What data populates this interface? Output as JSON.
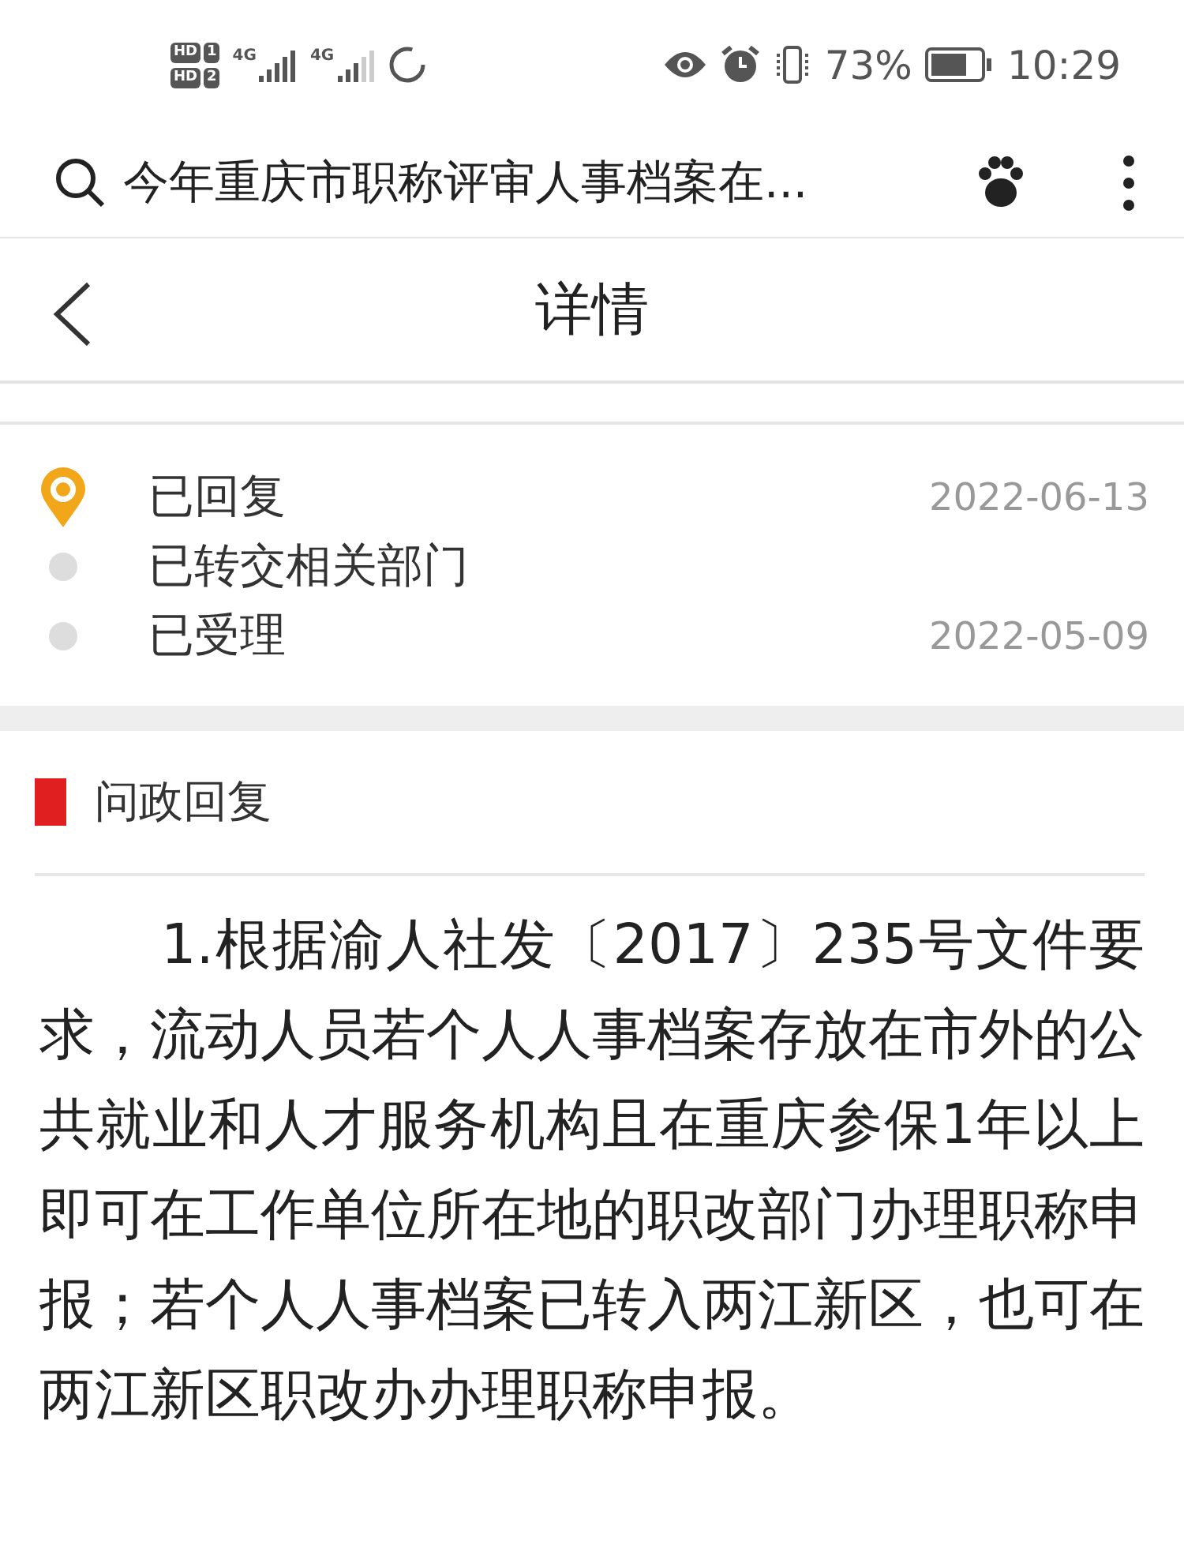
{
  "status_bar": {
    "sims": [
      {
        "hd": "HD",
        "slot": "1"
      },
      {
        "hd": "HD",
        "slot": "2"
      }
    ],
    "networks": [
      {
        "label": "4G"
      },
      {
        "label": "4G"
      }
    ],
    "battery": "73%",
    "time": "10:29"
  },
  "search_bar": {
    "query": "今年重庆市职称评审人事档案在..."
  },
  "header": {
    "title": "详情"
  },
  "timeline": [
    {
      "label": "已回复",
      "date": "2022-06-13",
      "selected": true
    },
    {
      "label": "已转交相关部门",
      "selected": false
    },
    {
      "label": "已受理",
      "date": "2022-05-09",
      "selected": false
    }
  ],
  "section": {
    "title": "问政回复"
  },
  "reply": "1.根据渝人社发〔2017〕235号文件要求，流动人员若个人人事档案存放在市外的公共就业和人才服务机构且在重庆参保1年以上即可在工作单位所在地的职改部门办理职称申报；若个人人事档案已转入两江新区，也可在两江新区职改办办理职称申报。"
}
